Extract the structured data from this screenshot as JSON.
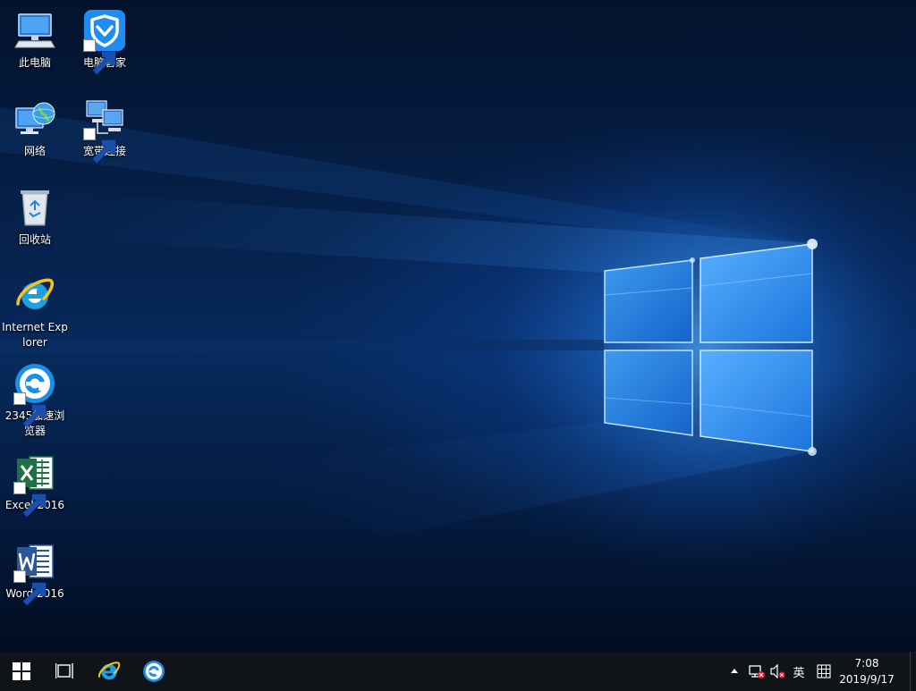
{
  "desktop": {
    "icons": [
      {
        "label": "此电脑",
        "icon": "computer-icon",
        "shortcut": false
      },
      {
        "label": "电脑管家",
        "icon": "pc-manager-shield-icon",
        "shortcut": true
      },
      {
        "label": "网络",
        "icon": "network-globe-icon",
        "shortcut": false
      },
      {
        "label": "宽带连接",
        "icon": "broadband-connection-icon",
        "shortcut": true
      },
      {
        "label": "回收站",
        "icon": "recycle-bin-icon",
        "shortcut": false
      },
      {
        "label": "Internet Explorer",
        "icon": "internet-explorer-icon",
        "shortcut": false
      },
      {
        "label": "2345加速浏览器",
        "icon": "2345-browser-icon",
        "shortcut": true
      },
      {
        "label": "Excel 2016",
        "icon": "excel-icon",
        "shortcut": true
      },
      {
        "label": "Word 2016",
        "icon": "word-icon",
        "shortcut": true
      }
    ]
  },
  "taskbar": {
    "start_icon": "windows-start-icon",
    "task_view_icon": "task-view-icon",
    "pinned": [
      {
        "icon": "internet-explorer-icon"
      },
      {
        "icon": "2345-browser-icon"
      }
    ],
    "tray": {
      "chevron_icon": "show-hidden-icons-chevron",
      "network_icon": "network-status-icon",
      "volume_icon": "volume-muted-icon",
      "ime_label": "英",
      "ime_mode_icon": "ime-mode-icon"
    },
    "clock": {
      "time": "7:08",
      "date": "2019/9/17"
    }
  },
  "colors": {
    "taskbar": "#101418",
    "wallpaper_glow": "#2f8ff0",
    "excel_green": "#1e7145",
    "word_blue": "#2b579a",
    "ie_blue": "#1ba1e2"
  }
}
